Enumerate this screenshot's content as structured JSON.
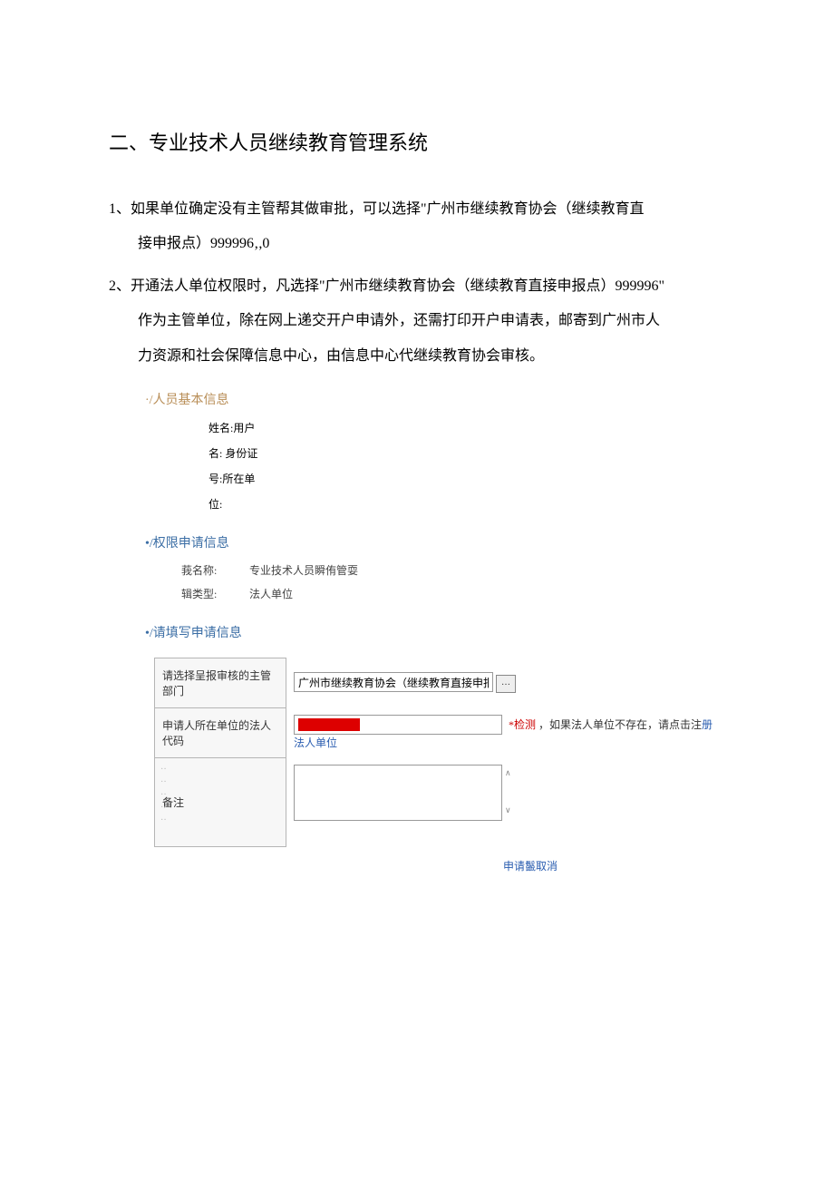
{
  "heading": "二、专业技术人员继续教育管理系统",
  "items": [
    {
      "num": "1、",
      "line1": "如果单位确定没有主管帮其做审批，可以选择\"广州市继续教育协会（继续教育直",
      "line2": "接申报点）999996‚,0"
    },
    {
      "num": "2、",
      "line1": "开通法人单位权限时，凡选择\"广州市继续教育协会（继续教育直接申报点）999996\"",
      "line2": "作为主管单位，除在网上递交开户申请外，还需打印开户申请表，邮寄到广州市人",
      "line3": "力资源和社会保障信息中心，由信息中心代继续教育协会审核。"
    }
  ],
  "sections": {
    "basic": {
      "title": "·/人员基本信息",
      "fields": [
        "姓名:用户",
        "名: 身份证",
        "号:所在单",
        "位:"
      ]
    },
    "auth": {
      "title": "•/权限申请信息",
      "rows": [
        {
          "label": "莪名称:",
          "value": "专业技术人员瞬侑管耍"
        },
        {
          "label": "辑类型:",
          "value": "法人单位"
        }
      ]
    },
    "fill": {
      "title": "•/请填写申请信息"
    }
  },
  "form": {
    "dept_label": "请选择呈报审核的主管部门",
    "dept_value": "广州市继续教育协会（继续教育直接申报点）",
    "picker": "…",
    "code_label": "申请人所在单位的法人代码",
    "code_value": "████████",
    "verify": "*检测",
    "hint_text": "，如果法人单位不存在，请点击注",
    "hint_link": "册法人单位",
    "remark_label": "备注",
    "remark_value": ""
  },
  "actions": {
    "submit_cancel": "申请鬣取消"
  }
}
